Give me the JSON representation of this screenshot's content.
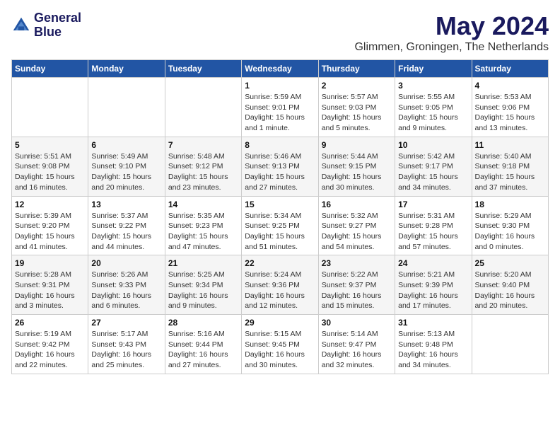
{
  "logo": {
    "line1": "General",
    "line2": "Blue"
  },
  "title": "May 2024",
  "location": "Glimmen, Groningen, The Netherlands",
  "days_of_week": [
    "Sunday",
    "Monday",
    "Tuesday",
    "Wednesday",
    "Thursday",
    "Friday",
    "Saturday"
  ],
  "weeks": [
    [
      {
        "day": "",
        "info": ""
      },
      {
        "day": "",
        "info": ""
      },
      {
        "day": "",
        "info": ""
      },
      {
        "day": "1",
        "info": "Sunrise: 5:59 AM\nSunset: 9:01 PM\nDaylight: 15 hours\nand 1 minute."
      },
      {
        "day": "2",
        "info": "Sunrise: 5:57 AM\nSunset: 9:03 PM\nDaylight: 15 hours\nand 5 minutes."
      },
      {
        "day": "3",
        "info": "Sunrise: 5:55 AM\nSunset: 9:05 PM\nDaylight: 15 hours\nand 9 minutes."
      },
      {
        "day": "4",
        "info": "Sunrise: 5:53 AM\nSunset: 9:06 PM\nDaylight: 15 hours\nand 13 minutes."
      }
    ],
    [
      {
        "day": "5",
        "info": "Sunrise: 5:51 AM\nSunset: 9:08 PM\nDaylight: 15 hours\nand 16 minutes."
      },
      {
        "day": "6",
        "info": "Sunrise: 5:49 AM\nSunset: 9:10 PM\nDaylight: 15 hours\nand 20 minutes."
      },
      {
        "day": "7",
        "info": "Sunrise: 5:48 AM\nSunset: 9:12 PM\nDaylight: 15 hours\nand 23 minutes."
      },
      {
        "day": "8",
        "info": "Sunrise: 5:46 AM\nSunset: 9:13 PM\nDaylight: 15 hours\nand 27 minutes."
      },
      {
        "day": "9",
        "info": "Sunrise: 5:44 AM\nSunset: 9:15 PM\nDaylight: 15 hours\nand 30 minutes."
      },
      {
        "day": "10",
        "info": "Sunrise: 5:42 AM\nSunset: 9:17 PM\nDaylight: 15 hours\nand 34 minutes."
      },
      {
        "day": "11",
        "info": "Sunrise: 5:40 AM\nSunset: 9:18 PM\nDaylight: 15 hours\nand 37 minutes."
      }
    ],
    [
      {
        "day": "12",
        "info": "Sunrise: 5:39 AM\nSunset: 9:20 PM\nDaylight: 15 hours\nand 41 minutes."
      },
      {
        "day": "13",
        "info": "Sunrise: 5:37 AM\nSunset: 9:22 PM\nDaylight: 15 hours\nand 44 minutes."
      },
      {
        "day": "14",
        "info": "Sunrise: 5:35 AM\nSunset: 9:23 PM\nDaylight: 15 hours\nand 47 minutes."
      },
      {
        "day": "15",
        "info": "Sunrise: 5:34 AM\nSunset: 9:25 PM\nDaylight: 15 hours\nand 51 minutes."
      },
      {
        "day": "16",
        "info": "Sunrise: 5:32 AM\nSunset: 9:27 PM\nDaylight: 15 hours\nand 54 minutes."
      },
      {
        "day": "17",
        "info": "Sunrise: 5:31 AM\nSunset: 9:28 PM\nDaylight: 15 hours\nand 57 minutes."
      },
      {
        "day": "18",
        "info": "Sunrise: 5:29 AM\nSunset: 9:30 PM\nDaylight: 16 hours\nand 0 minutes."
      }
    ],
    [
      {
        "day": "19",
        "info": "Sunrise: 5:28 AM\nSunset: 9:31 PM\nDaylight: 16 hours\nand 3 minutes."
      },
      {
        "day": "20",
        "info": "Sunrise: 5:26 AM\nSunset: 9:33 PM\nDaylight: 16 hours\nand 6 minutes."
      },
      {
        "day": "21",
        "info": "Sunrise: 5:25 AM\nSunset: 9:34 PM\nDaylight: 16 hours\nand 9 minutes."
      },
      {
        "day": "22",
        "info": "Sunrise: 5:24 AM\nSunset: 9:36 PM\nDaylight: 16 hours\nand 12 minutes."
      },
      {
        "day": "23",
        "info": "Sunrise: 5:22 AM\nSunset: 9:37 PM\nDaylight: 16 hours\nand 15 minutes."
      },
      {
        "day": "24",
        "info": "Sunrise: 5:21 AM\nSunset: 9:39 PM\nDaylight: 16 hours\nand 17 minutes."
      },
      {
        "day": "25",
        "info": "Sunrise: 5:20 AM\nSunset: 9:40 PM\nDaylight: 16 hours\nand 20 minutes."
      }
    ],
    [
      {
        "day": "26",
        "info": "Sunrise: 5:19 AM\nSunset: 9:42 PM\nDaylight: 16 hours\nand 22 minutes."
      },
      {
        "day": "27",
        "info": "Sunrise: 5:17 AM\nSunset: 9:43 PM\nDaylight: 16 hours\nand 25 minutes."
      },
      {
        "day": "28",
        "info": "Sunrise: 5:16 AM\nSunset: 9:44 PM\nDaylight: 16 hours\nand 27 minutes."
      },
      {
        "day": "29",
        "info": "Sunrise: 5:15 AM\nSunset: 9:45 PM\nDaylight: 16 hours\nand 30 minutes."
      },
      {
        "day": "30",
        "info": "Sunrise: 5:14 AM\nSunset: 9:47 PM\nDaylight: 16 hours\nand 32 minutes."
      },
      {
        "day": "31",
        "info": "Sunrise: 5:13 AM\nSunset: 9:48 PM\nDaylight: 16 hours\nand 34 minutes."
      },
      {
        "day": "",
        "info": ""
      }
    ]
  ]
}
